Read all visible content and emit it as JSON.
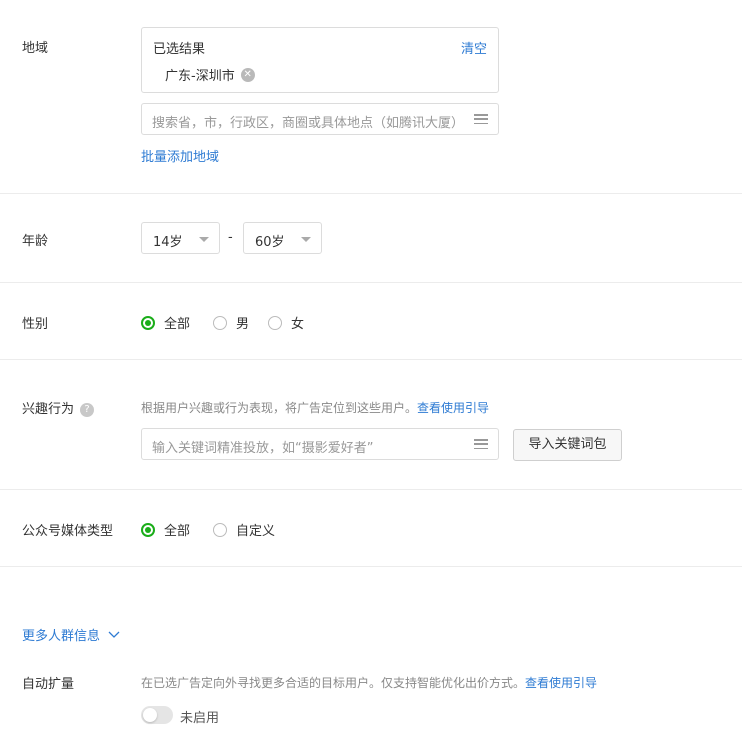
{
  "region": {
    "label": "地域",
    "selected_title": "已选结果",
    "clear": "清空",
    "chip": "广东-深圳市",
    "search_placeholder": "搜索省，市，行政区，商圈或具体地点（如腾讯大厦）",
    "batch_add": "批量添加地域"
  },
  "age": {
    "label": "年龄",
    "min": "14岁",
    "sep": "-",
    "max": "60岁"
  },
  "gender": {
    "label": "性别",
    "options": [
      "全部",
      "男",
      "女"
    ],
    "selected": "全部"
  },
  "interest": {
    "label": "兴趣行为",
    "hint": "根据用户兴趣或行为表现，将广告定位到这些用户。",
    "guide_link": "查看使用引导",
    "keyword_placeholder": "输入关键词精准投放，如“摄影爱好者”",
    "import_button": "导入关键词包"
  },
  "media_type": {
    "label": "公众号媒体类型",
    "options": [
      "全部",
      "自定义"
    ],
    "selected": "全部"
  },
  "more": {
    "label": "更多人群信息"
  },
  "auto_expand": {
    "label": "自动扩量",
    "hint": "在已选广告定向外寻找更多合适的目标用户。仅支持智能优化出价方式。",
    "guide_link": "查看使用引导",
    "toggle_label": "未启用",
    "enabled": false
  },
  "colors": {
    "accent": "#1aad19",
    "link": "#2e7bd3"
  }
}
